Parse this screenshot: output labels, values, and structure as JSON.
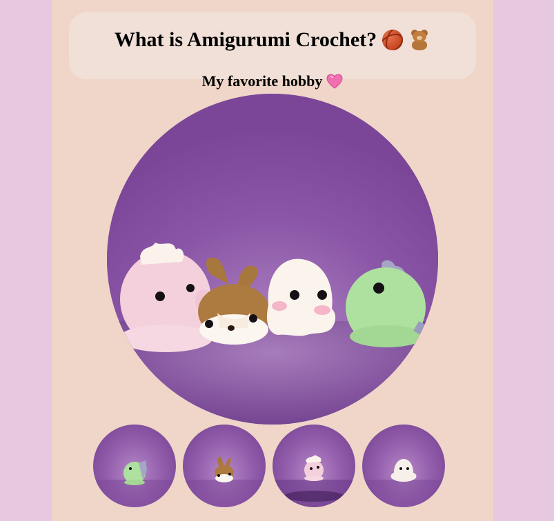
{
  "header": {
    "title": "What is Amigurumi Crochet?",
    "title_icons": [
      "yarn-icon",
      "teddy-bear-icon"
    ],
    "subtitle": "My favorite hobby",
    "subtitle_icon": "pink-heart-icon"
  },
  "main_photo": {
    "subject": "four crochet amigurumi plushies: pink, brown bunny, white ghost, green dinosaur",
    "background_color": "#8a55a6"
  },
  "thumbnails": [
    {
      "subject": "green dinosaur"
    },
    {
      "subject": "brown bunny"
    },
    {
      "subject": "pink plushie"
    },
    {
      "subject": "white ghost"
    }
  ],
  "colors": {
    "outer_background": "#e6c8e0",
    "page_background": "#efd6c8",
    "header_card": "#f1e0d8"
  }
}
